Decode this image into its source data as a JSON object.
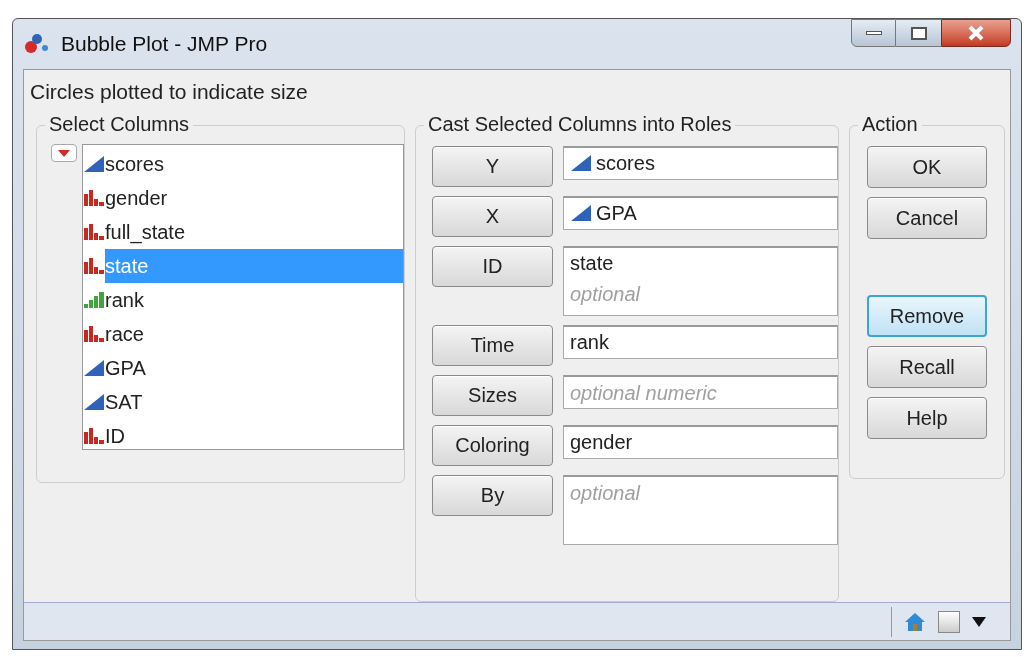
{
  "window": {
    "title": "Bubble Plot - JMP Pro"
  },
  "description": "Circles plotted to indicate size",
  "select_columns": {
    "title": "Select Columns",
    "items": [
      {
        "label": "scores",
        "kind": "continuous",
        "selected": false
      },
      {
        "label": "gender",
        "kind": "nominal",
        "selected": false
      },
      {
        "label": "full_state",
        "kind": "nominal",
        "selected": false
      },
      {
        "label": "state",
        "kind": "nominal",
        "selected": true
      },
      {
        "label": "rank",
        "kind": "ordinal",
        "selected": false
      },
      {
        "label": "race",
        "kind": "nominal",
        "selected": false
      },
      {
        "label": "GPA",
        "kind": "continuous",
        "selected": false
      },
      {
        "label": "SAT",
        "kind": "continuous",
        "selected": false
      },
      {
        "label": "ID",
        "kind": "nominal",
        "selected": false
      }
    ]
  },
  "roles": {
    "title": "Cast Selected Columns into Roles",
    "items": [
      {
        "button": "Y",
        "value": "scores",
        "kind": "continuous",
        "tall": false
      },
      {
        "button": "X",
        "value": "GPA",
        "kind": "continuous",
        "tall": false
      },
      {
        "button": "ID",
        "value": "state",
        "placeholder": "optional",
        "kind": "plain",
        "tall": true
      },
      {
        "button": "Time",
        "value": "rank",
        "kind": "plain",
        "tall": false
      },
      {
        "button": "Sizes",
        "placeholder": "optional numeric",
        "tall": false
      },
      {
        "button": "Coloring",
        "value": "gender",
        "kind": "plain",
        "tall": false
      },
      {
        "button": "By",
        "placeholder": "optional",
        "tall": true
      }
    ]
  },
  "action": {
    "title": "Action",
    "buttons": [
      {
        "label": "OK",
        "focused": false,
        "gap_before": false
      },
      {
        "label": "Cancel",
        "focused": false,
        "gap_before": false
      },
      {
        "label": "Remove",
        "focused": true,
        "gap_before": true
      },
      {
        "label": "Recall",
        "focused": false,
        "gap_before": false
      },
      {
        "label": "Help",
        "focused": false,
        "gap_before": false
      }
    ]
  }
}
